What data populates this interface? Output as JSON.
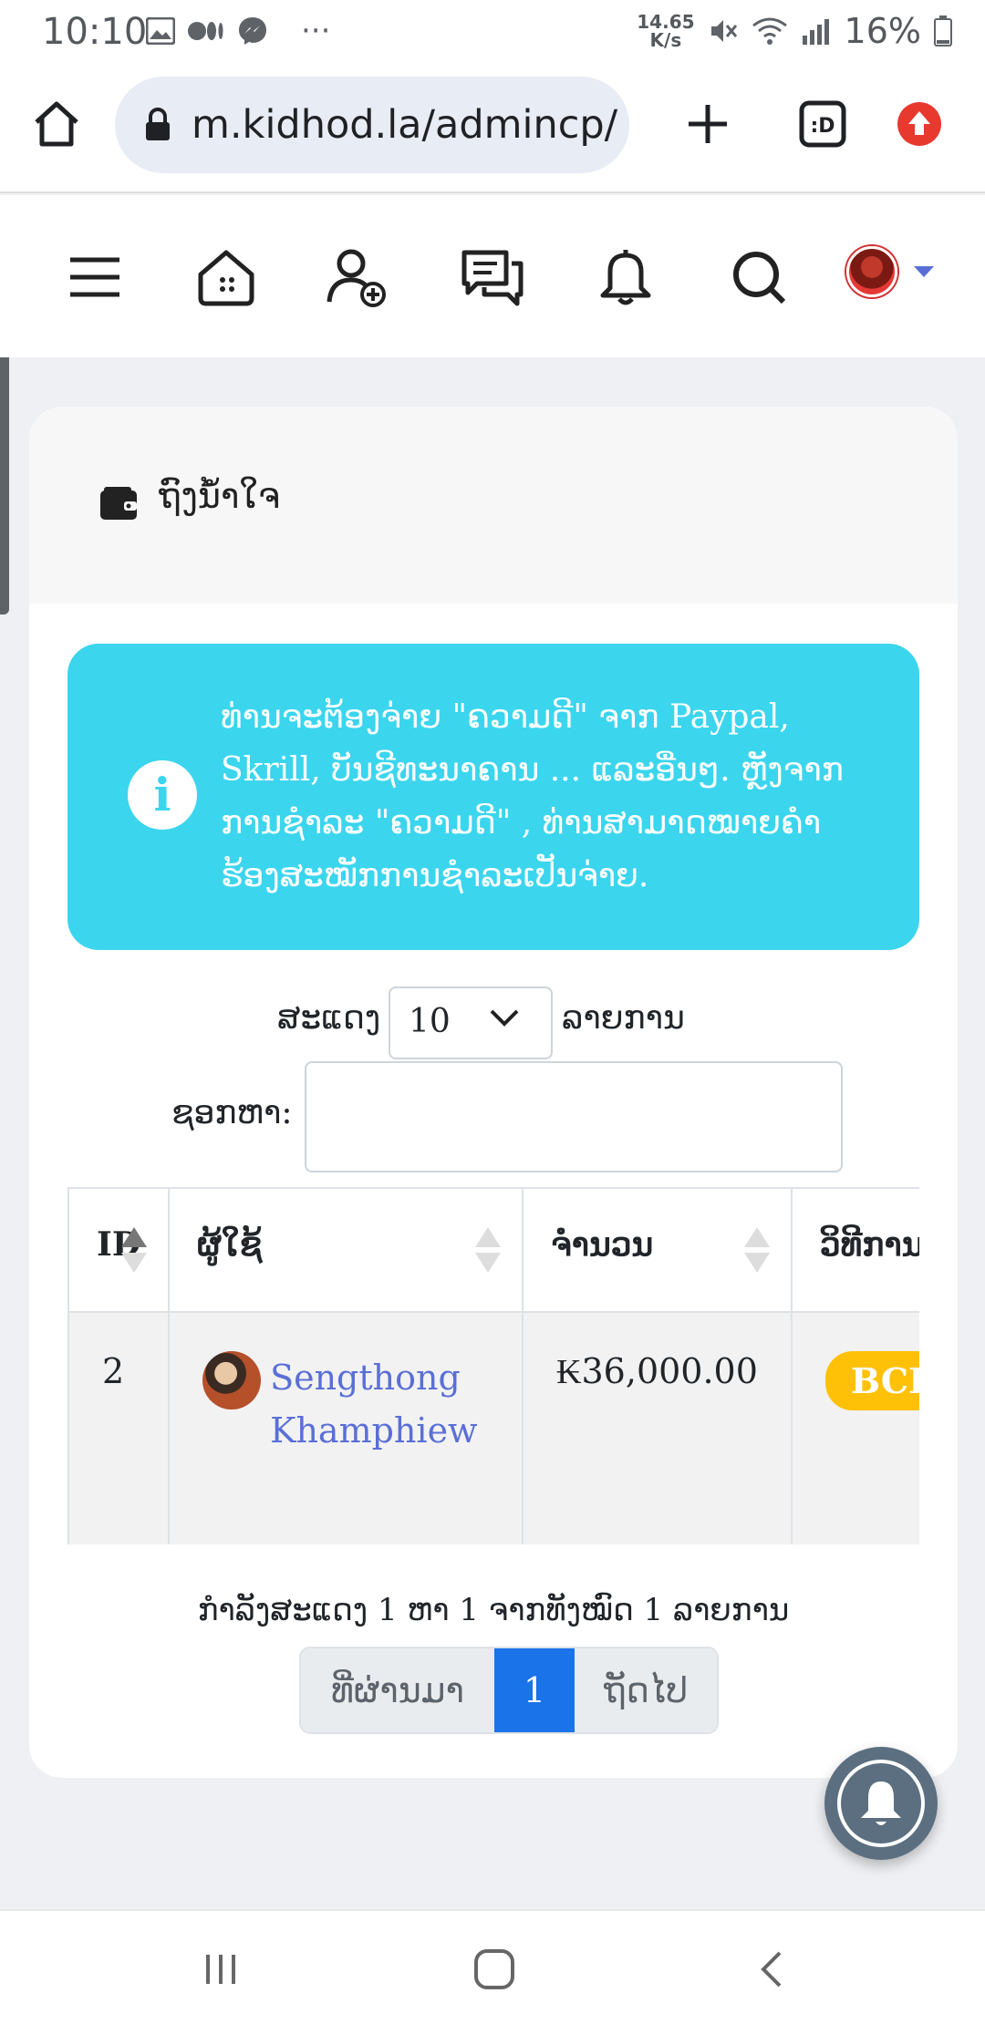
{
  "status_bar": {
    "time": "10:10",
    "speed_top": "14.65",
    "speed_bottom": "K/s",
    "battery": "16%",
    "more": "···"
  },
  "browser": {
    "url": "m.kidhod.la/admincp/"
  },
  "page": {
    "title": "ຖົງນ້ຳໃຈ",
    "alert_text": "ທ່ານຈະຕ້ອງຈ່າຍ \"ຄວາມດີ\" ຈາກ Paypal, Skrill, ບັນຊີທະນາຄານ ... ແລະອື່ນໆ. ຫຼັງຈາກການຊຳລະ \"ຄວາມດີ\" , ທ່ານສາມາດໝາຍຄຳຮ້ອງສະໝັກການຊຳລະເປັນຈ່າຍ.",
    "length_label": "ສະແດງ",
    "length_value": "10",
    "length_suffix": "ລາຍການ",
    "search_label": "ຊອກຫາ:",
    "search_value": ""
  },
  "table": {
    "headers": [
      "ID",
      "ຜູ້ໃຊ້",
      "ຈຳນວນ",
      "ວິທີການ"
    ],
    "rows": [
      {
        "id": "2",
        "user": "Sengthong Khamphiew",
        "amount": "₭36,000.00",
        "method": "BCEL One"
      }
    ]
  },
  "pagination": {
    "info": "ກຳລັງສະແດງ 1 ຫາ 1 ຈາກທັງໝົດ 1 ລາຍການ",
    "prev": "ທີ່ຜ່ານມາ",
    "current": "1",
    "next": "ຖັດໄປ"
  },
  "colors": {
    "accent": "#1a73e8",
    "alert": "#3bd5ee",
    "badge": "#ffc107",
    "link": "#5a6fd6"
  }
}
